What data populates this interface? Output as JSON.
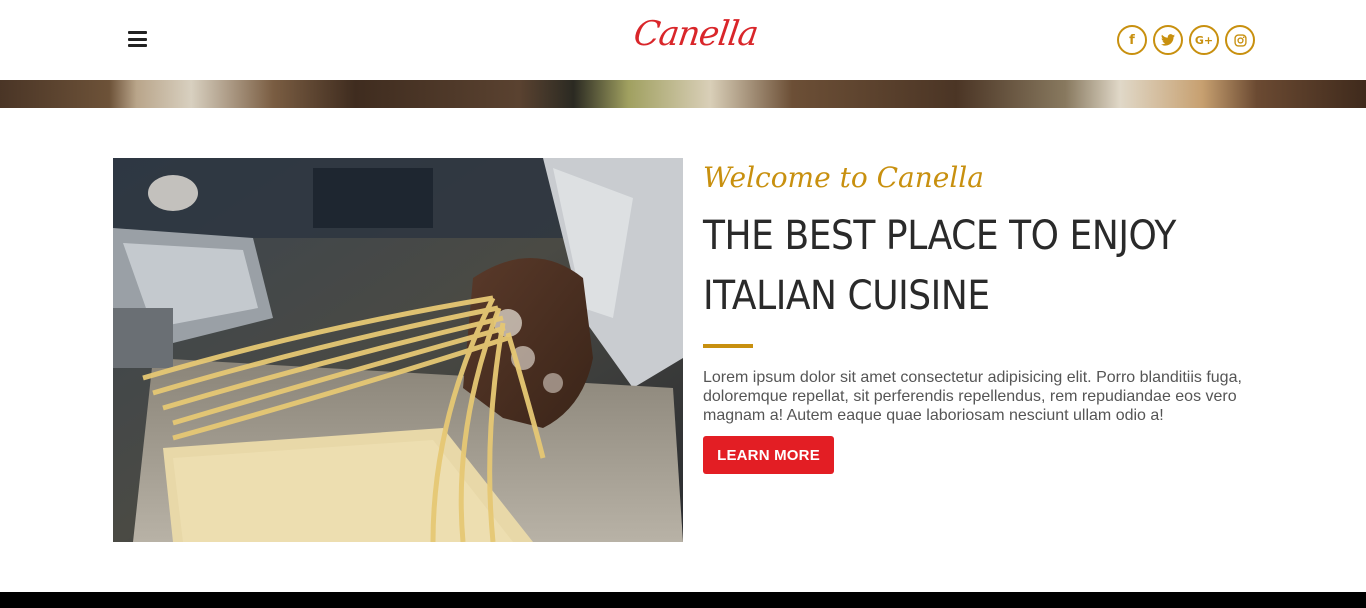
{
  "header": {
    "logo_text": "Canella",
    "menu_icon": "hamburger-menu-icon",
    "social": [
      {
        "name": "facebook-icon",
        "glyph": "f"
      },
      {
        "name": "twitter-icon",
        "glyph": "t"
      },
      {
        "name": "google-plus-icon",
        "glyph": "G+"
      },
      {
        "name": "instagram-icon",
        "glyph": "◎"
      }
    ]
  },
  "about": {
    "welcome": "Welcome to Canella",
    "headline": "THE BEST PLACE TO ENJOY ITALIAN CUISINE",
    "body": "Lorem ipsum dolor sit amet consectetur adipisicing elit. Porro blanditiis fuga, doloremque repellat, sit perferendis repellendus, rem repudiandae eos vero magnam a! Autem eaque quae laboriosam nesciunt ullam odio a!",
    "button_label": "LEARN MORE"
  },
  "colors": {
    "brand_red": "#d9262a",
    "accent_gold": "#c8900f",
    "button_red": "#e31e24",
    "headline": "#2a2a2a",
    "body_text": "#555555"
  }
}
